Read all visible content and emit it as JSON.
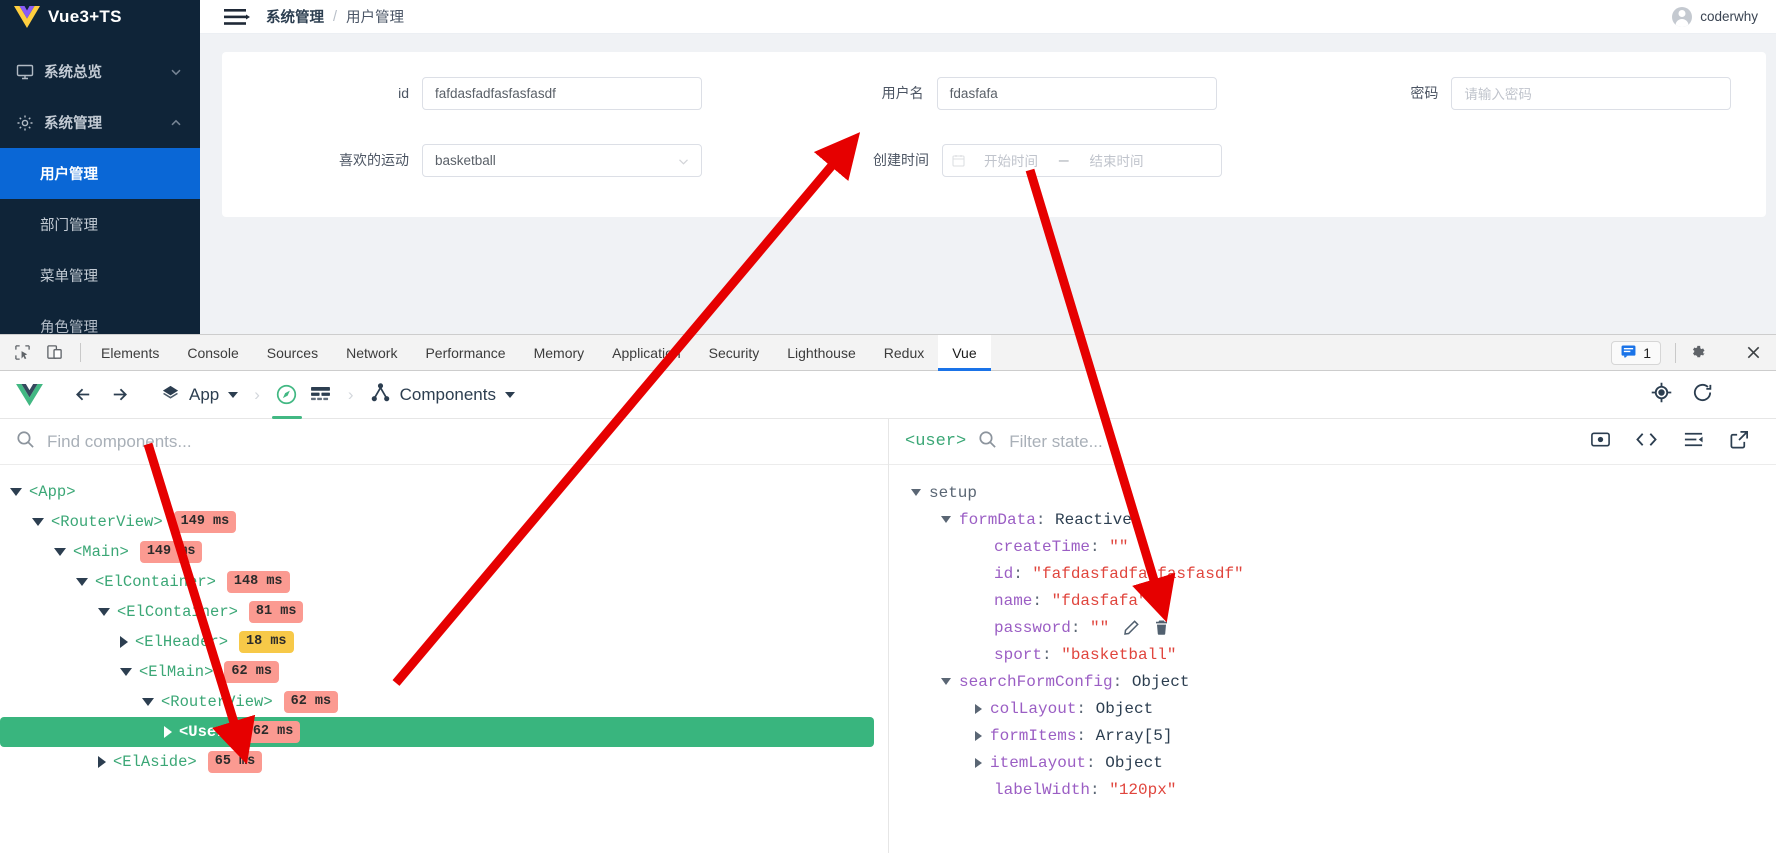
{
  "app": {
    "brand": "Vue3+TS",
    "sidebar": {
      "groups": [
        {
          "label": "系统总览",
          "icon": "monitor-icon",
          "chevron": "chevron-down-icon"
        },
        {
          "label": "系统管理",
          "icon": "gear-icon",
          "chevron": "chevron-up-icon"
        }
      ],
      "items": [
        {
          "label": "用户管理",
          "active": true
        },
        {
          "label": "部门管理",
          "active": false
        },
        {
          "label": "菜单管理",
          "active": false
        },
        {
          "label": "角色管理",
          "active": false
        }
      ]
    },
    "topbar": {
      "menu_icon": "hamburger-icon",
      "breadcrumb": {
        "parent": "系统管理",
        "separator": "/",
        "current": "用户管理"
      },
      "user": "coderwhy"
    },
    "search_form": {
      "fields": [
        {
          "label": "id",
          "value": "fafdasfadfasfasfasdf",
          "placeholder": "",
          "type": "text"
        },
        {
          "label": "用户名",
          "value": "fdasfafa",
          "placeholder": "",
          "type": "text"
        },
        {
          "label": "密码",
          "value": "",
          "placeholder": "请输入密码",
          "type": "text"
        },
        {
          "label": "喜欢的运动",
          "value": "basketball",
          "placeholder": "",
          "type": "select"
        },
        {
          "label": "创建时间",
          "start_placeholder": "开始时间",
          "range_separator": "－",
          "end_placeholder": "结束时间",
          "type": "daterange"
        }
      ]
    }
  },
  "devtools": {
    "tool_icons": [
      "inspect-element-icon",
      "device-toolbar-icon"
    ],
    "tabs": [
      {
        "label": "Elements",
        "active": false
      },
      {
        "label": "Console",
        "active": false
      },
      {
        "label": "Sources",
        "active": false
      },
      {
        "label": "Network",
        "active": false
      },
      {
        "label": "Performance",
        "active": false
      },
      {
        "label": "Memory",
        "active": false
      },
      {
        "label": "Application",
        "active": false
      },
      {
        "label": "Security",
        "active": false
      },
      {
        "label": "Lighthouse",
        "active": false
      },
      {
        "label": "Redux",
        "active": false
      },
      {
        "label": "Vue",
        "active": true
      }
    ],
    "message_count": "1",
    "right_icons": [
      "message-icon",
      "settings-gear-icon",
      "more-options-icon",
      "close-devtools-icon"
    ]
  },
  "vue_devtools": {
    "toolbar": {
      "logo": "vue-logo-icon",
      "back": "back-arrow-icon",
      "forward": "forward-arrow-icon",
      "app_label": "App",
      "app_icon": "app-diamond-icon",
      "separator": "›",
      "view_icons": [
        "compass-icon",
        "table-icon"
      ],
      "panel_label": "Components",
      "panel_icon": "components-tree-icon",
      "right_icons": [
        "select-component-icon",
        "refresh-icon",
        "more-options-icon"
      ]
    },
    "tree_search_placeholder": "Find components...",
    "tree_search_icon": "search-icon",
    "tree": [
      {
        "depth": 0,
        "name": "<App>",
        "ms": "",
        "toggle": "open",
        "selected": false
      },
      {
        "depth": 1,
        "name": "<RouterView>",
        "ms": "149 ms",
        "toggle": "open",
        "selected": false
      },
      {
        "depth": 2,
        "name": "<Main>",
        "ms": "149 ms",
        "toggle": "open",
        "selected": false
      },
      {
        "depth": 3,
        "name": "<ElContainer>",
        "ms": "148 ms",
        "toggle": "open",
        "selected": false
      },
      {
        "depth": 4,
        "name": "<ElContainer>",
        "ms": "81 ms",
        "toggle": "open",
        "selected": false
      },
      {
        "depth": 5,
        "name": "<ElHeader>",
        "ms": "18 ms",
        "toggle": "closed",
        "selected": false
      },
      {
        "depth": 5,
        "name": "<ElMain>",
        "ms": "62 ms",
        "toggle": "open",
        "selected": false
      },
      {
        "depth": 6,
        "name": "<RouterView>",
        "ms": "62 ms",
        "toggle": "open",
        "selected": false
      },
      {
        "depth": 7,
        "name": "<User>",
        "ms": "62 ms",
        "toggle": "closed",
        "selected": true
      },
      {
        "depth": 4,
        "name": "<ElAside>",
        "ms": "65 ms",
        "toggle": "closed",
        "selected": false
      }
    ],
    "state_header": {
      "component": "<user>",
      "search_icon": "search-icon",
      "filter_placeholder": "Filter state...",
      "right_icons": [
        "eye-icon",
        "code-icon",
        "collapse-icon",
        "open-external-icon"
      ]
    },
    "state": [
      {
        "depth": 0,
        "toggle": "open",
        "key": "setup",
        "kind": "plain"
      },
      {
        "depth": 1,
        "toggle": "open",
        "key": "formData",
        "value": "Reactive",
        "kind": "type"
      },
      {
        "depth": 2,
        "toggle": "none",
        "key": "createTime",
        "value": "\"\"",
        "kind": "string"
      },
      {
        "depth": 2,
        "toggle": "none",
        "key": "id",
        "value": "\"fafdasfadfasfasfasdf\"",
        "kind": "string"
      },
      {
        "depth": 2,
        "toggle": "none",
        "key": "name",
        "value": "\"fdasfafa\"",
        "kind": "string"
      },
      {
        "depth": 2,
        "toggle": "none",
        "key": "password",
        "value": "\"\"",
        "kind": "string",
        "actions": [
          "edit-icon",
          "delete-icon",
          "more-icon"
        ]
      },
      {
        "depth": 2,
        "toggle": "none",
        "key": "sport",
        "value": "\"basketball\"",
        "kind": "string"
      },
      {
        "depth": 1,
        "toggle": "open",
        "key": "searchFormConfig",
        "value": "Object",
        "kind": "type"
      },
      {
        "depth": 2,
        "toggle": "closed",
        "key": "colLayout",
        "value": "Object",
        "kind": "type"
      },
      {
        "depth": 2,
        "toggle": "closed",
        "key": "formItems",
        "value": "Array[5]",
        "kind": "type"
      },
      {
        "depth": 2,
        "toggle": "closed",
        "key": "itemLayout",
        "value": "Object",
        "kind": "type"
      },
      {
        "depth": 2,
        "toggle": "none",
        "key": "labelWidth",
        "value": "\"120px\"",
        "kind": "string"
      }
    ]
  },
  "colors": {
    "sidebar_bg": "#0f2438",
    "sidebar_active": "#0a67d6",
    "vue_green": "#42b883",
    "devtools_accent": "#1a73e8",
    "badge_red": "#fb9a91",
    "badge_yellow": "#f7c948",
    "annotation_arrow": "#e60000"
  }
}
